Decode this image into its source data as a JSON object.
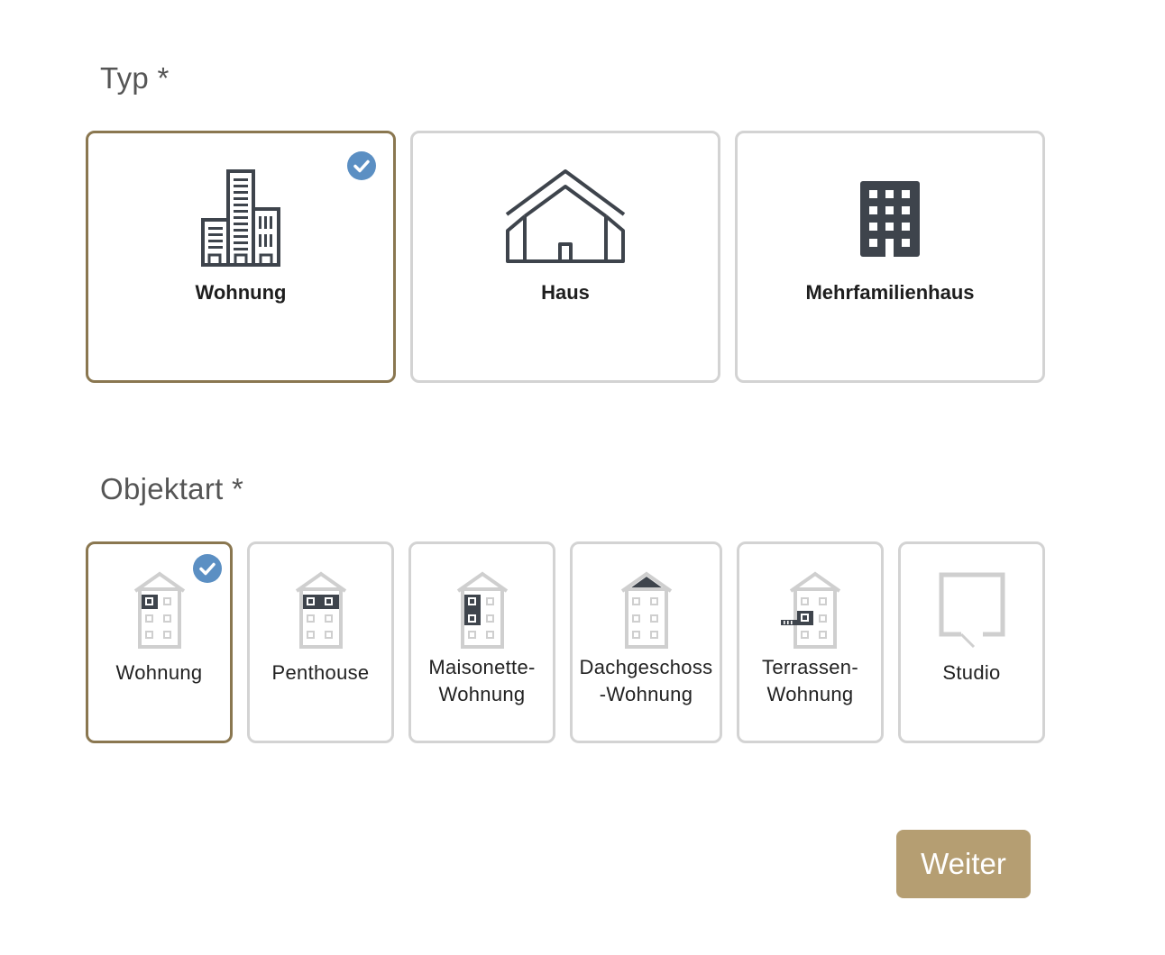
{
  "typ": {
    "label": "Typ *",
    "options": [
      {
        "label": "Wohnung",
        "icon": "city-buildings-icon",
        "selected": true
      },
      {
        "label": "Haus",
        "icon": "house-icon",
        "selected": false
      },
      {
        "label": "Mehrfamilienhaus",
        "icon": "apartment-building-icon",
        "selected": false
      }
    ]
  },
  "objektart": {
    "label": "Objektart *",
    "options": [
      {
        "label": "Wohnung",
        "icon": "apartment-unit-icon",
        "selected": true
      },
      {
        "label": "Penthouse",
        "icon": "penthouse-icon",
        "selected": false
      },
      {
        "label_line1": "Maisonette-",
        "label_line2": "Wohnung",
        "icon": "maisonette-icon",
        "selected": false
      },
      {
        "label_line1": "Dachgeschoss",
        "label_line2": "-Wohnung",
        "icon": "attic-apartment-icon",
        "selected": false
      },
      {
        "label_line1": "Terrassen-",
        "label_line2": "Wohnung",
        "icon": "terrace-apartment-icon",
        "selected": false
      },
      {
        "label": "Studio",
        "icon": "studio-icon",
        "selected": false
      }
    ]
  },
  "actions": {
    "next_label": "Weiter"
  },
  "colors": {
    "selected_border": "#8a7750",
    "card_border": "#d3d3d3",
    "check_badge": "#5b8fc3",
    "button_bg": "#b59e72",
    "icon_dark": "#3e444c"
  }
}
